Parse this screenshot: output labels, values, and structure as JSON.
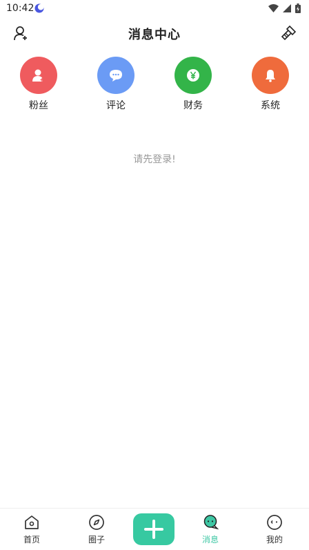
{
  "status": {
    "time": "10:42"
  },
  "header": {
    "title": "消息中心"
  },
  "categories": [
    {
      "label": "粉丝",
      "color": "#ef5b5e",
      "icon": "user-plus-icon"
    },
    {
      "label": "评论",
      "color": "#6b9bf5",
      "icon": "chat-bubble-icon"
    },
    {
      "label": "财务",
      "color": "#33b449",
      "icon": "yen-icon"
    },
    {
      "label": "系统",
      "color": "#ef6b3c",
      "icon": "bell-icon"
    }
  ],
  "empty_message": "请先登录!",
  "nav": {
    "items": [
      {
        "label": "首页",
        "icon": "home-icon"
      },
      {
        "label": "圈子",
        "icon": "compass-icon"
      },
      {
        "label": "消息",
        "icon": "message-icon",
        "active": true
      },
      {
        "label": "我的",
        "icon": "profile-icon"
      }
    ],
    "accent": "#3ec7a4"
  }
}
